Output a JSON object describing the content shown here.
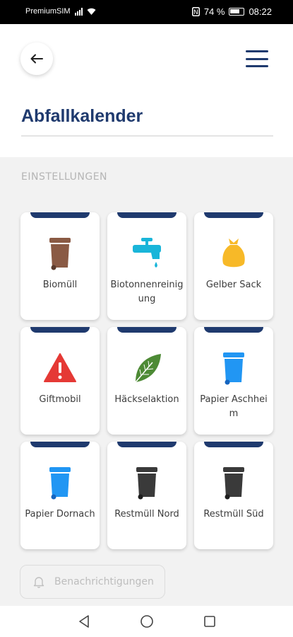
{
  "status_bar": {
    "carrier": "PremiumSIM",
    "battery": "74 %",
    "time": "08:22"
  },
  "header": {
    "title": "Abfallkalender"
  },
  "section": {
    "label": "EINSTELLUNGEN"
  },
  "cards": [
    {
      "label": "Biomüll",
      "icon": "brown-bin-icon",
      "color": "#8a5a44"
    },
    {
      "label": "Biotonnenreinigung",
      "icon": "water-tap-icon",
      "color": "#19b5d9"
    },
    {
      "label": "Gelber Sack",
      "icon": "yellow-bag-icon",
      "color": "#f7b928"
    },
    {
      "label": "Giftmobil",
      "icon": "warning-icon",
      "color": "#e53935"
    },
    {
      "label": "Häckselaktion",
      "icon": "leaf-icon",
      "color": "#4d8a35"
    },
    {
      "label": "Papier Aschheim",
      "icon": "blue-bin-icon",
      "color": "#2196f3"
    },
    {
      "label": "Papier Dornach",
      "icon": "blue-bin-icon",
      "color": "#2196f3"
    },
    {
      "label": "Restmüll Nord",
      "icon": "black-bin-icon",
      "color": "#3a3a3a"
    },
    {
      "label": "Restmüll Süd",
      "icon": "black-bin-icon",
      "color": "#3a3a3a"
    }
  ],
  "notifications": {
    "label": "Benachrichtigungen",
    "icon": "bell-icon"
  },
  "colors": {
    "primary": "#1f3a6e",
    "background": "#f2f2f2"
  }
}
